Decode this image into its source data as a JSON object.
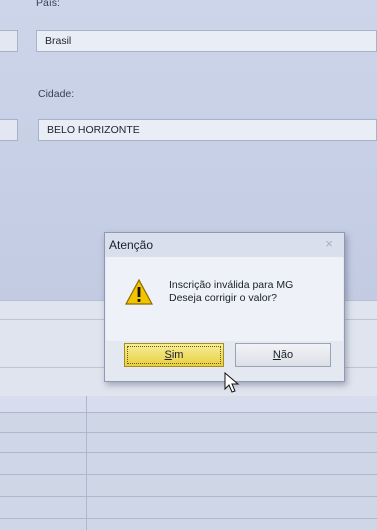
{
  "form": {
    "country_label": "País:",
    "country_value": "Brasil",
    "city_label": "Cidade:",
    "city_value": "BELO HORIZONTE"
  },
  "dialog": {
    "title": "Atenção",
    "close_glyph": "×",
    "message_line1": "Inscrição inválida para MG",
    "message_line2": "Deseja corrigir o valor?",
    "icon": "warning-icon",
    "yes_button": {
      "accel": "S",
      "rest": "im"
    },
    "no_button": {
      "accel": "N",
      "rest": "ão"
    }
  },
  "colors": {
    "default_button": "#e7cf3f",
    "warning": "#f2c400"
  }
}
